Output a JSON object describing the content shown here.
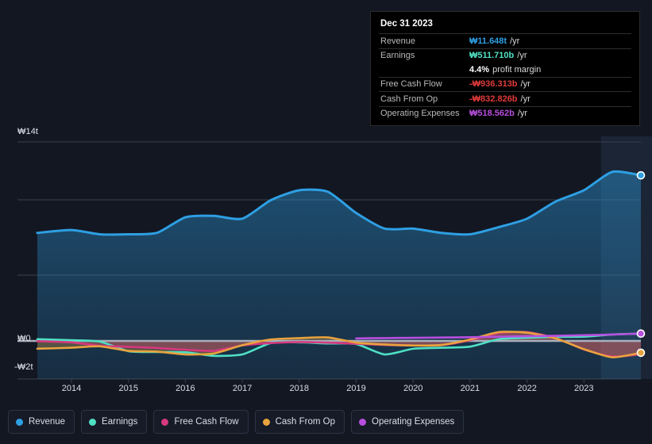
{
  "chart_data": {
    "type": "line",
    "title": "",
    "xlabel": "",
    "ylabel": "",
    "currency": "₩",
    "ylim": [
      -2,
      14
    ],
    "ytick_labels": [
      "₩14t",
      "₩0",
      "-₩2t"
    ],
    "ytick_values": [
      14,
      0,
      -2
    ],
    "grid": true,
    "legend_position": "bottom-left",
    "x": [
      2013.4,
      2014,
      2014.5,
      2015,
      2015.5,
      2016,
      2016.5,
      2017,
      2017.5,
      2018,
      2018.5,
      2019,
      2019.5,
      2020,
      2020.5,
      2021,
      2021.5,
      2022,
      2022.5,
      2023,
      2023.5,
      2024.0
    ],
    "categories": [
      "2014",
      "2015",
      "2016",
      "2017",
      "2018",
      "2019",
      "2020",
      "2021",
      "2022",
      "2023"
    ],
    "series": [
      {
        "name": "Revenue",
        "color": "#2e9fe3",
        "fill": true,
        "values": [
          7.6,
          7.8,
          7.5,
          7.5,
          7.6,
          8.7,
          8.8,
          8.6,
          9.9,
          10.6,
          10.5,
          9.0,
          7.9,
          7.9,
          7.6,
          7.5,
          8.0,
          8.6,
          9.8,
          10.6,
          11.9,
          11.648
        ]
      },
      {
        "name": "Earnings",
        "color": "#4fe0c4",
        "fill": false,
        "values": [
          0.12,
          0.05,
          -0.05,
          -0.72,
          -0.78,
          -0.8,
          -1.05,
          -0.95,
          -0.15,
          -0.1,
          -0.18,
          -0.22,
          -0.95,
          -0.55,
          -0.48,
          -0.4,
          0.12,
          0.22,
          0.28,
          0.3,
          0.45,
          0.51171
        ]
      },
      {
        "name": "Free Cash Flow",
        "color": "#d6397f",
        "fill": true,
        "values": [
          -0.02,
          -0.1,
          -0.35,
          -0.42,
          -0.5,
          -0.62,
          -0.7,
          -0.32,
          -0.15,
          -0.08,
          -0.12,
          -0.2,
          -0.28,
          -0.32,
          -0.3,
          0.05,
          0.55,
          0.62,
          0.2,
          -0.6,
          -1.1,
          -0.936313
        ]
      },
      {
        "name": "Cash From Op",
        "color": "#e8a33d",
        "fill": true,
        "values": [
          -0.55,
          -0.48,
          -0.38,
          -0.7,
          -0.75,
          -0.95,
          -0.88,
          -0.3,
          0.1,
          0.2,
          0.25,
          -0.12,
          -0.25,
          -0.32,
          -0.28,
          0.1,
          0.62,
          0.58,
          0.18,
          -0.58,
          -1.15,
          -0.832826
        ]
      },
      {
        "name": "Operating Expenses",
        "color": "#b84fe0",
        "fill": false,
        "start_x": 2019,
        "values": [
          null,
          null,
          null,
          null,
          null,
          null,
          null,
          null,
          null,
          null,
          null,
          0.18,
          0.2,
          0.22,
          0.24,
          0.26,
          0.3,
          0.33,
          0.36,
          0.4,
          0.45,
          0.518562
        ]
      }
    ],
    "forecast_band": {
      "start": 2023.3,
      "end": 2024.0,
      "label": ""
    },
    "annotations": []
  },
  "axis": {
    "y_top_label": "₩14t",
    "y_zero_label": "₩0",
    "y_neg_label": "-₩2t",
    "x_labels": [
      "2014",
      "2015",
      "2016",
      "2017",
      "2018",
      "2019",
      "2020",
      "2021",
      "2022",
      "2023"
    ]
  },
  "legend": {
    "items": [
      {
        "label": "Revenue",
        "color": "#2e9fe3"
      },
      {
        "label": "Earnings",
        "color": "#4fe0c4"
      },
      {
        "label": "Free Cash Flow",
        "color": "#d6397f"
      },
      {
        "label": "Cash From Op",
        "color": "#e8a33d"
      },
      {
        "label": "Operating Expenses",
        "color": "#b84fe0"
      }
    ]
  },
  "tooltip": {
    "date": "Dec 31 2023",
    "rows": [
      {
        "label": "Revenue",
        "value": "₩11.648t",
        "suffix": "/yr",
        "color": "#2e9fe3"
      },
      {
        "label": "Earnings",
        "value": "₩511.710b",
        "suffix": "/yr",
        "color": "#4fe0c4"
      },
      {
        "label": "Free Cash Flow",
        "value": "-₩936.313b",
        "suffix": "/yr",
        "color": "#e03a3a"
      },
      {
        "label": "Cash From Op",
        "value": "-₩832.826b",
        "suffix": "/yr",
        "color": "#e03a3a"
      },
      {
        "label": "Operating Expenses",
        "value": "₩518.562b",
        "suffix": "/yr",
        "color": "#b84fe0"
      }
    ],
    "profit_margin_value": "4.4%",
    "profit_margin_label": "profit margin"
  }
}
